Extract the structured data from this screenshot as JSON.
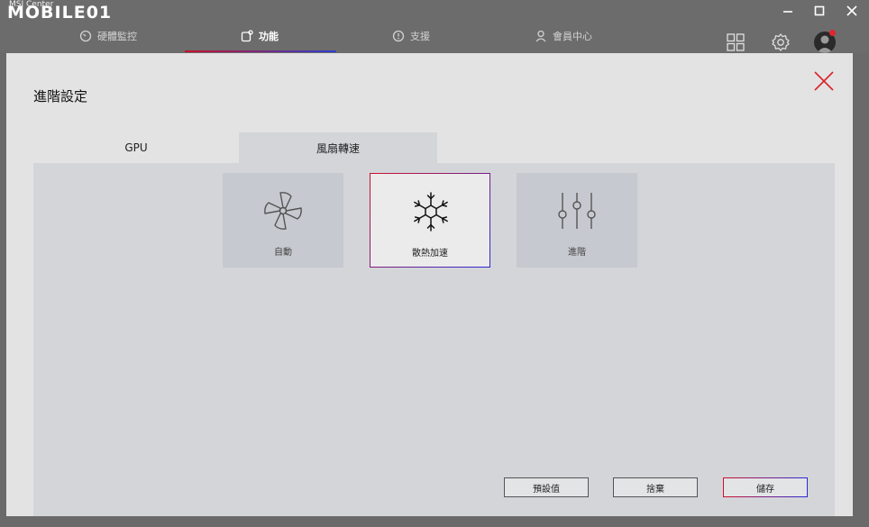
{
  "app": {
    "title": "MSI Center",
    "watermark": "MOBILE01"
  },
  "nav": {
    "items": [
      {
        "label": "硬體監控"
      },
      {
        "label": "功能"
      },
      {
        "label": "支援"
      },
      {
        "label": "會員中心"
      }
    ],
    "active": "功能"
  },
  "panel": {
    "title": "進階設定",
    "tabs": [
      {
        "label": "GPU"
      },
      {
        "label": "風扇轉速"
      }
    ],
    "active_tab": "風扇轉速",
    "modes": [
      {
        "label": "自動",
        "icon": "fan-icon"
      },
      {
        "label": "散熱加速",
        "icon": "snowflake-icon"
      },
      {
        "label": "進階",
        "icon": "sliders-icon"
      }
    ],
    "selected_mode": "散熱加速",
    "buttons": {
      "default": "預設值",
      "discard": "捨棄",
      "save": "儲存"
    }
  },
  "colors": {
    "accent_red": "#c8102e",
    "accent_blue": "#2f3fd0",
    "close_red": "#d9232d"
  }
}
